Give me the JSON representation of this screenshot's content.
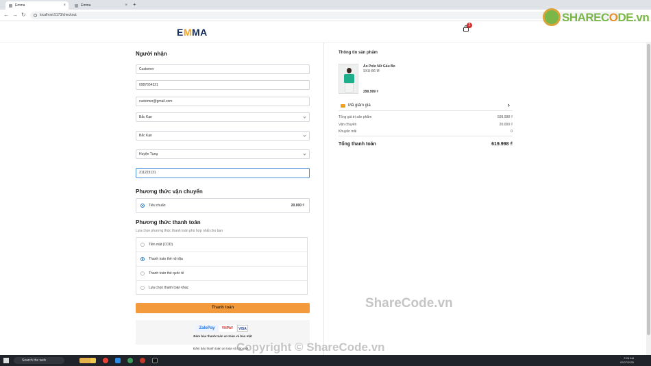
{
  "browser": {
    "tabs": [
      {
        "label": "Emma"
      },
      {
        "label": "Emma"
      }
    ],
    "new_tab": "+",
    "close": "×",
    "back": "←",
    "forward": "→",
    "reload": "↻",
    "url": "localhost:5173/checkout"
  },
  "header": {
    "logo_prefix": "E",
    "logo_accent": "M",
    "logo_suffix": "MA",
    "cart_count": "2"
  },
  "watermark_logo": {
    "prefix": "SHAREC",
    "o": "O",
    "suffix": "DE.vn"
  },
  "recipient": {
    "title": "Người nhận",
    "name": "Customer",
    "phone": "0987654321",
    "email": "customer@gmail.com",
    "province": "Bắc Kạn",
    "district": "Bắc Kạn",
    "ward": "Huyện Tụng",
    "address": "311223131"
  },
  "shipping": {
    "title": "Phương thức vận chuyển",
    "option": "Tiêu chuẩn",
    "price": "20.000 ₫"
  },
  "payment": {
    "title": "Phương thức thanh toán",
    "subtitle": "Lựa chọn phương thức thanh toán phù hợp nhất cho bạn",
    "options": [
      {
        "label": "Tiền mặt (COD)",
        "selected": false
      },
      {
        "label": "Thanh toán thẻ nội địa",
        "selected": true
      },
      {
        "label": "Thanh toán thẻ quốc tế",
        "selected": false
      },
      {
        "label": "Lựa chọn thanh toán khác",
        "selected": false
      }
    ],
    "submit_label": "Thanh toán",
    "badges": {
      "zalo": "ZaloPay",
      "vnpay": "VNPAY",
      "visa": "VISA"
    },
    "secure_note": "Đảm bảo thanh toán an toàn và bảo mật",
    "secure_note_2": "Đảm bảo thanh toán an toàn và bảo mật"
  },
  "product": {
    "section_title": "Thông tin sản phẩm",
    "name": "Áo Polo Nữ Gấu Bo",
    "sku": "SKU-B6 M",
    "price": "299.999 ₫"
  },
  "coupon": {
    "label": "Mã giảm giá",
    "arrow": "›"
  },
  "summary": {
    "rows": [
      {
        "label": "Tổng giá trị sản phẩm",
        "value": "599.998 ₫"
      },
      {
        "label": "Vận chuyển",
        "value": "20.000 ₫"
      },
      {
        "label": "Khuyến mãi",
        "value": "0"
      }
    ],
    "total_label": "Tổng thanh toán",
    "total_value": "619.998 ₫"
  },
  "overlay": {
    "brand": "ShareCode.vn",
    "copyright": "Copyright © ShareCode.vn"
  },
  "taskbar": {
    "search_placeholder": "Search the web",
    "time": "2:28 AM",
    "date": "02/07/2025"
  },
  "colors": {
    "accent_orange": "#f39a3d",
    "radio_blue": "#1e73c8",
    "logo_navy": "#0f2a5a"
  }
}
